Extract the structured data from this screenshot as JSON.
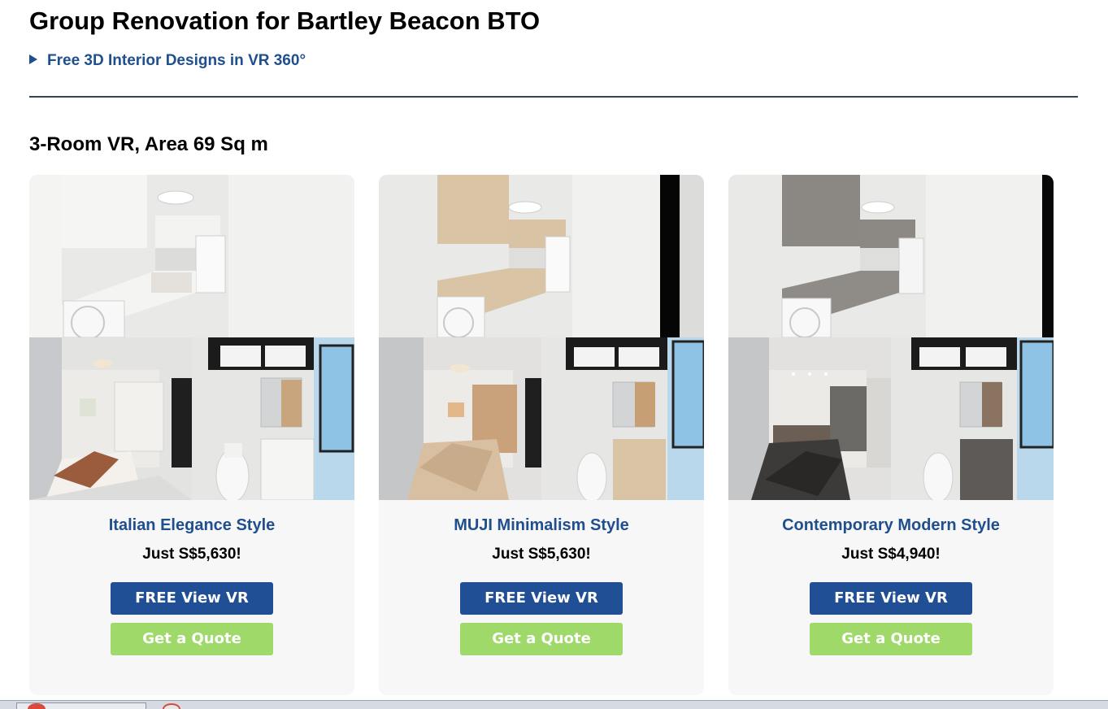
{
  "page": {
    "title": "Group Renovation for Bartley Beacon BTO",
    "details_summary": "Free 3D Interior Designs in VR 360°",
    "section_heading": "3-Room VR, Area 69 Sq m"
  },
  "cards": [
    {
      "style_name": "Italian Elegance Style",
      "price": "Just S$5,630!",
      "vr_label": "FREE View VR",
      "quote_label": "Get a Quote"
    },
    {
      "style_name": "MUJI Minimalism Style",
      "price": "Just S$5,630!",
      "vr_label": "FREE View VR",
      "quote_label": "Get a Quote"
    },
    {
      "style_name": "Contemporary Modern Style",
      "price": "Just S$4,940!",
      "vr_label": "FREE View VR",
      "quote_label": "Get a Quote"
    }
  ],
  "colors": {
    "heading_blue": "#204f8e",
    "vr_button": "#204f96",
    "quote_button": "#9fd96a",
    "card_background": "#f7f7f7"
  }
}
